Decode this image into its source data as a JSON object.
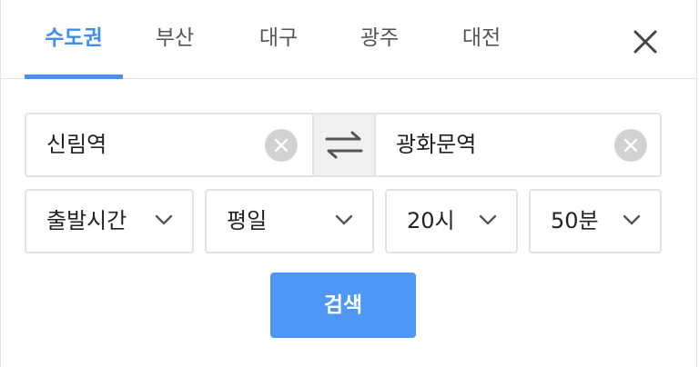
{
  "tabs": [
    {
      "label": "수도권",
      "active": true
    },
    {
      "label": "부산",
      "active": false
    },
    {
      "label": "대구",
      "active": false
    },
    {
      "label": "광주",
      "active": false
    },
    {
      "label": "대전",
      "active": false
    }
  ],
  "route": {
    "from": "신림역",
    "to": "광화문역"
  },
  "options": {
    "departure_type": "출발시간",
    "day_type": "평일",
    "hour": "20시",
    "minute": "50분"
  },
  "search_label": "검색",
  "colors": {
    "accent": "#3d8ef0",
    "button": "#4f97f7",
    "border": "#e3e3e3"
  },
  "icons": {
    "close": "close-icon",
    "clear": "clear-circle-icon",
    "swap": "swap-arrows-icon",
    "dropdown": "chevron-down-icon"
  }
}
